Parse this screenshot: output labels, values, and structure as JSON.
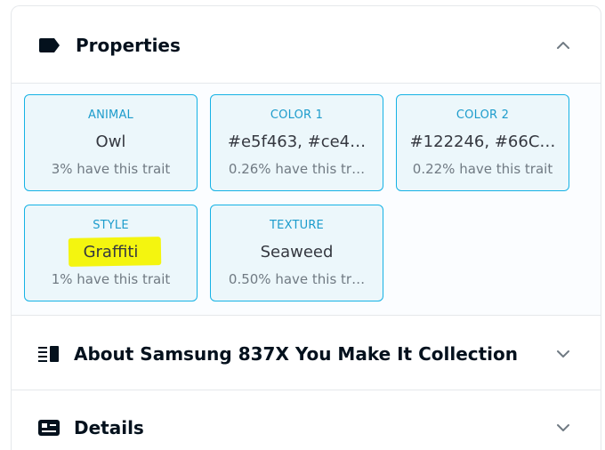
{
  "sections": {
    "properties": {
      "title": "Properties",
      "icon": "tag-icon",
      "state": "expanded"
    },
    "about": {
      "title": "About Samsung 837X You Make It Collection",
      "icon": "list-icon",
      "state": "collapsed"
    },
    "details": {
      "title": "Details",
      "icon": "card-icon",
      "state": "collapsed"
    }
  },
  "traits": [
    {
      "type": "ANIMAL",
      "value": "Owl",
      "rarity": "3% have this trait"
    },
    {
      "type": "COLOR 1",
      "value": "#e5f463, #ce4…",
      "rarity": "0.26% have this tr…"
    },
    {
      "type": "COLOR 2",
      "value": "#122246, #66C…",
      "rarity": "0.22% have this trait"
    },
    {
      "type": "STYLE",
      "value": "Graffiti",
      "rarity": "1% have this trait",
      "highlighted": true
    },
    {
      "type": "TEXTURE",
      "value": "Seaweed",
      "rarity": "0.50% have this tr…"
    }
  ],
  "colors": {
    "accent": "#15b2e5",
    "card_bg": "#ecf7fb",
    "highlight": "#f4f50f",
    "text": "#04111d"
  }
}
